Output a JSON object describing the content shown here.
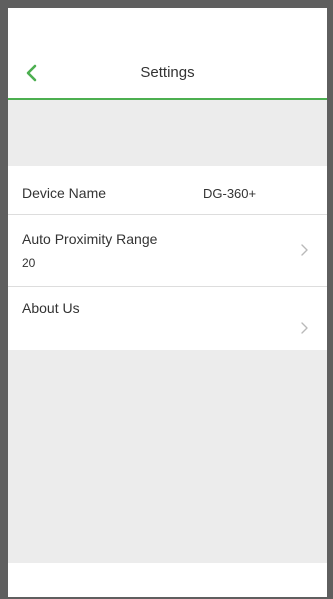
{
  "colors": {
    "accent": "#4caf50",
    "background": "#ececec",
    "text": "#333333",
    "chevron": "#b9b9b9"
  },
  "nav": {
    "title": "Settings",
    "back_icon": "chevron-left-icon"
  },
  "settings": {
    "device_name": {
      "label": "Device Name",
      "value": "DG-360+"
    },
    "auto_proximity_range": {
      "label": "Auto Proximity Range",
      "value": "20",
      "icon": "chevron-right-icon"
    },
    "about_us": {
      "label": "About Us",
      "icon": "chevron-right-icon"
    }
  }
}
